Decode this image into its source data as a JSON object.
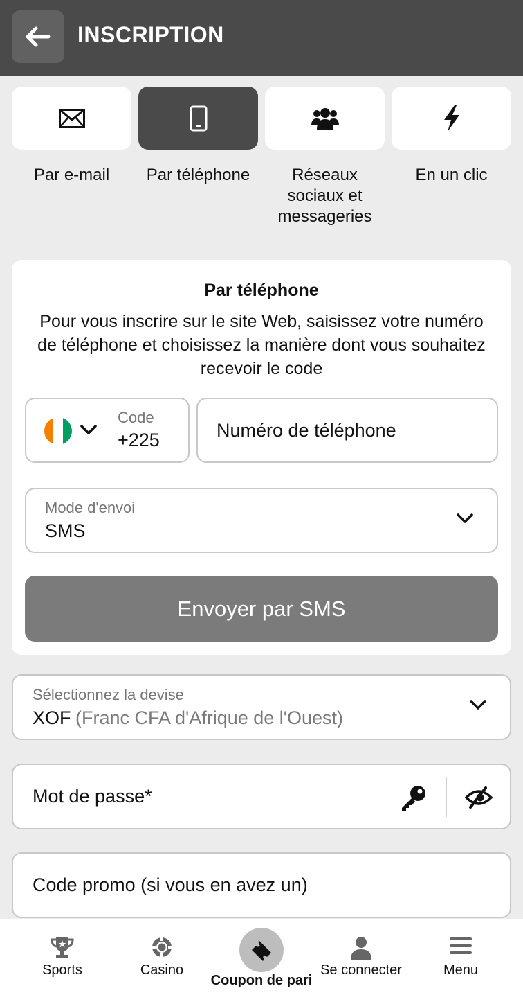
{
  "header": {
    "title": "INSCRIPTION"
  },
  "methods": [
    {
      "label": "Par e-mail",
      "icon": "envelope-icon"
    },
    {
      "label": "Par téléphone",
      "icon": "phone-icon",
      "active": true
    },
    {
      "label": "Réseaux sociaux et messageries",
      "icon": "people-icon"
    },
    {
      "label": "En un clic",
      "icon": "lightning-icon"
    }
  ],
  "form": {
    "title": "Par téléphone",
    "description": "Pour vous inscrire sur le site Web, saisissez votre numéro de téléphone et choisissez la manière dont vous souhaitez recevoir le code",
    "code_caption": "Code",
    "code_value": "+225",
    "phone_placeholder": "Numéro de téléphone",
    "mode_caption": "Mode d'envoi",
    "mode_value": "SMS",
    "send_label": "Envoyer par SMS",
    "flag_colors": [
      "#f77f00",
      "#ffffff",
      "#009e60"
    ]
  },
  "currency": {
    "caption": "Sélectionnez la devise",
    "code": "XOF",
    "name": "(Franc CFA d'Afrique de l'Ouest)"
  },
  "password": {
    "placeholder": "Mot de passe*"
  },
  "promo": {
    "placeholder": "Code promo (si vous en avez un)"
  },
  "nav": {
    "sports": "Sports",
    "casino": "Casino",
    "coupon": "Coupon de pari",
    "login": "Se connecter",
    "menu": "Menu"
  }
}
